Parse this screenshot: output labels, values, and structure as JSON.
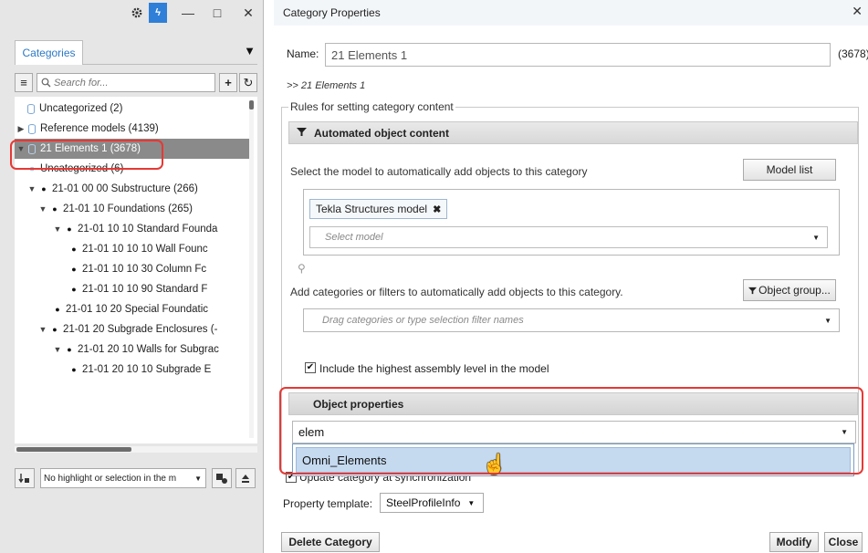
{
  "left_panel": {
    "titlebar": {
      "gear_icon": "gear-icon",
      "lightning_label": "ϟ",
      "minimize_icon": "—",
      "maximize_icon": "□",
      "close_icon": "✕"
    },
    "tab_label": "Categories",
    "tab_dropdown_icon": "▼",
    "search": {
      "placeholder": "Search for...",
      "add_icon": "+",
      "refresh_icon": "↻",
      "collapse_icon": "≡"
    },
    "tree": [
      {
        "label": "Uncategorized (2)",
        "type": "cyl",
        "indent": 1
      },
      {
        "label": "Reference models (4139)",
        "type": "cyl-arrow",
        "indent": 0
      },
      {
        "label": "21 Elements 1 (3678)",
        "type": "selected",
        "indent": 0
      },
      {
        "label": "Uncategorized (6)",
        "type": "circle",
        "indent": 1
      },
      {
        "label": "21-01 00 00 Substructure (266)",
        "type": "bullet-arrow",
        "indent": 1
      },
      {
        "label": "21-01 10 Foundations (265)",
        "type": "bullet-arrow",
        "indent": 2
      },
      {
        "label": "21-01 10 10 Standard Founda",
        "type": "bullet-arrow",
        "indent": 3
      },
      {
        "label": "21-01 10 10 10 Wall Founc",
        "type": "bullet",
        "indent": 4
      },
      {
        "label": "21-01 10 10 30 Column Fc",
        "type": "bullet",
        "indent": 4
      },
      {
        "label": "21-01 10 10 90 Standard F",
        "type": "bullet",
        "indent": 4
      },
      {
        "label": "21-01 10 20 Special Foundatic",
        "type": "bullet",
        "indent": 3
      },
      {
        "label": "21-01 20  Subgrade Enclosures (-",
        "type": "bullet-arrow",
        "indent": 2
      },
      {
        "label": "21-01 20 10 Walls for Subgrac",
        "type": "bullet-arrow",
        "indent": 3
      },
      {
        "label": "21-01 20 10 10 Subgrade E",
        "type": "bullet",
        "indent": 4
      }
    ],
    "highlight_select": "No highlight or selection in the m"
  },
  "right_panel": {
    "title": "Category Properties",
    "close_icon": "✕",
    "name_label": "Name:",
    "name_value": "21 Elements 1",
    "count": "(3678)",
    "path": ">> 21 Elements 1",
    "rules_legend": "Rules for setting category content",
    "automated_header": "Automated object content",
    "select_model_instruction": "Select the model to automatically add objects to this category",
    "model_list_button": "Model list",
    "model_chip": "Tekla Structures model",
    "select_model_placeholder": "Select model",
    "categories_instruction": "Add categories or filters to automatically add objects to this category.",
    "object_group_button": "Object group...",
    "drag_placeholder": "Drag categories or type selection filter names",
    "include_highest_label": "Include the highest assembly level in the model",
    "include_highest_checked": true,
    "object_properties_header": "Object properties",
    "property_input_value": "elem",
    "dropdown_option": "Omni_Elements",
    "update_sync_label": "Update category at synchronization",
    "update_sync_checked": true,
    "property_template_label": "Property template:",
    "property_template_value": "SteelProfileInfo",
    "delete_button": "Delete Category",
    "modify_button": "Modify",
    "close_button": "Close"
  },
  "colors": {
    "accent_blue": "#2b78c5",
    "selection_gray": "#8a8a8a",
    "annotation_red": "#e53935",
    "dropdown_highlight": "#c5d9ef"
  }
}
